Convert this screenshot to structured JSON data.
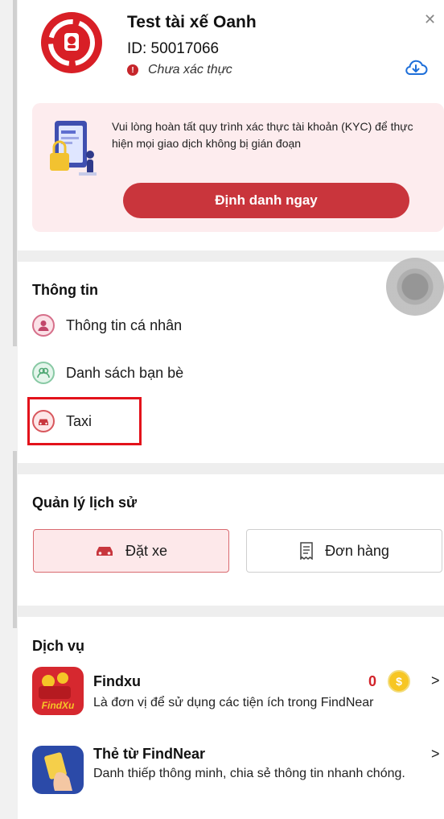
{
  "profile": {
    "name": "Test tài xế Oanh",
    "id_text": "ID: 50017066",
    "verify_status": "Chưa xác thực",
    "close_icon": "close-icon",
    "cloud_icon": "cloud-download-icon"
  },
  "kyc": {
    "message": "Vui lòng hoàn tất quy trình xác thực tài khoản (KYC) để thực hiện mọi giao dịch không bị gián đoạn",
    "button_label": "Định danh ngay"
  },
  "info": {
    "title": "Thông tin",
    "items": [
      {
        "label": "Thông tin cá nhân",
        "icon": "user-icon"
      },
      {
        "label": "Danh sách bạn bè",
        "icon": "friends-icon"
      },
      {
        "label": "Taxi",
        "icon": "taxi-icon"
      }
    ]
  },
  "history": {
    "title": "Quản lý lịch sử",
    "tabs": [
      {
        "label": "Đặt xe",
        "icon": "car-icon",
        "active": true
      },
      {
        "label": "Đơn hàng",
        "icon": "receipt-icon",
        "active": false
      }
    ]
  },
  "services": {
    "title": "Dịch vụ",
    "items": [
      {
        "title": "Findxu",
        "desc": "Là đơn vị để sử dụng các tiện ích trong FindNear",
        "count": "0",
        "coin_symbol": "$",
        "logo_text": "FindXu"
      },
      {
        "title": "Thẻ từ FindNear",
        "desc": "Danh thiếp thông minh, chia sẻ thông tin nhanh chóng."
      }
    ]
  },
  "colors": {
    "brand_red": "#d81f26",
    "button_red": "#c9353c",
    "banner_pink": "#fdecee",
    "highlight_border": "#e3121b"
  }
}
